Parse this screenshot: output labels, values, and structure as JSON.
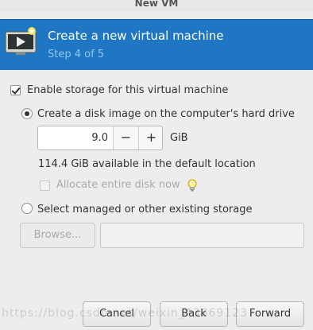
{
  "window": {
    "title": "New VM"
  },
  "header": {
    "icon": "vm-monitor-icon",
    "title": "Create a new virtual machine",
    "step": "Step 4 of 5",
    "colors": {
      "background": "#1f76c2",
      "step_text": "#93c4ef"
    }
  },
  "storage": {
    "enable_label": "Enable storage for this virtual machine",
    "enable_checked": true,
    "create_disk_label": "Create a disk image on the computer's hard drive",
    "create_disk_selected": true,
    "size_value": "9.0",
    "size_unit": "GiB",
    "available_text": "114.4 GiB available in the default location",
    "allocate_label": "Allocate entire disk now",
    "allocate_checked": false,
    "allocate_hint_icon": "lightbulb-icon",
    "managed_label": "Select managed or other existing storage",
    "managed_selected": false,
    "browse_label": "Browse...",
    "path_value": ""
  },
  "footer": {
    "cancel_label": "Cancel",
    "back_label": "Back",
    "forward_label": "Forward"
  },
  "watermark": "https://blog.csdn.net/weixin_43669123"
}
